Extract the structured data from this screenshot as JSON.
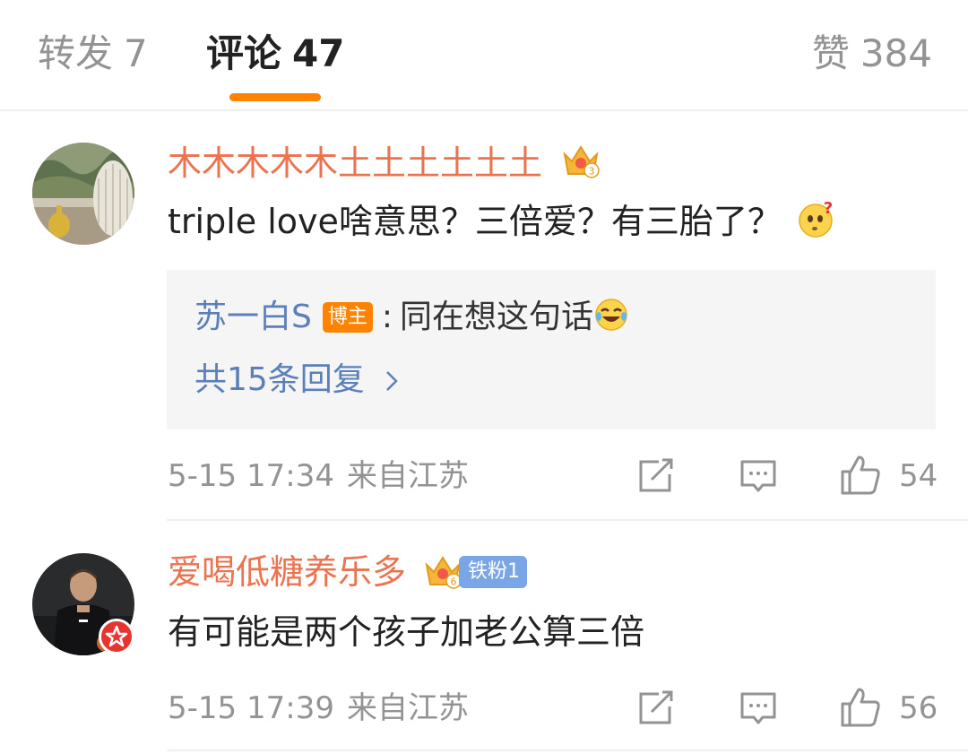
{
  "tabs": {
    "repost": {
      "label": "转发",
      "count": "7"
    },
    "comment": {
      "label": "评论",
      "count": "47"
    },
    "like": {
      "label": "赞",
      "count": "384"
    }
  },
  "accent_color": "#ff8200",
  "username_color": "#eb7350",
  "link_color": "#5b7fb8",
  "comments": [
    {
      "username": "木木木木木土土土土土土",
      "badge_icon": "crown-level-icon",
      "badge_level": "3",
      "text": "triple love啥意思？三倍爱？有三胎了？",
      "text_emoji": "thinking-question-emoji",
      "reply": {
        "user": "苏一白S",
        "tag": "博主",
        "separator": ":",
        "text": "同在想这句话",
        "emoji": "laughing-tears-emoji",
        "more": "共15条回复"
      },
      "time": "5-15 17:34",
      "source": "来自江苏",
      "likes": "54"
    },
    {
      "username": "爱喝低糖养乐多",
      "badge_icon": "crown-level-icon",
      "badge_level": "6",
      "fan_badge": "铁粉1",
      "text": "有可能是两个孩子加老公算三倍",
      "time": "5-15 17:39",
      "source": "来自江苏",
      "likes": "56"
    }
  ]
}
